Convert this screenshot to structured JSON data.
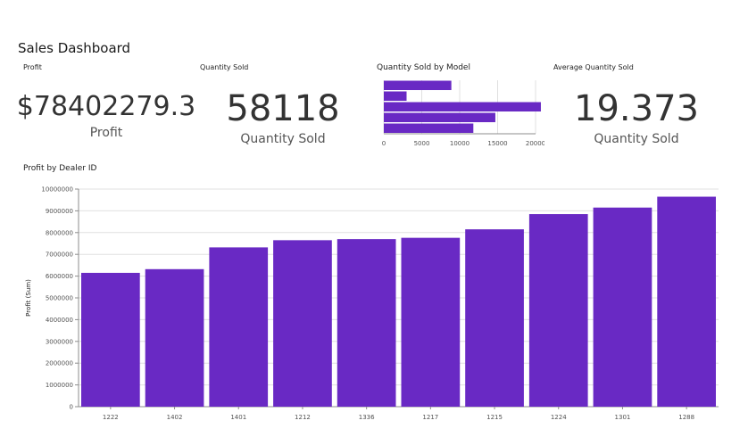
{
  "dashboard": {
    "title": "Sales Dashboard"
  },
  "tiles": {
    "profit": {
      "title": "Profit",
      "value": "$78402279.3",
      "label": "Profit"
    },
    "quantity": {
      "title": "Quantity Sold",
      "value": "58118",
      "label": "Quantity Sold"
    },
    "model": {
      "title": "Quantity Sold by Model"
    },
    "average": {
      "title": "Average Quantity Sold",
      "value": "19.373",
      "label": "Quantity Sold"
    },
    "dealer": {
      "title": "Profit by Dealer ID"
    }
  },
  "colors": {
    "bar": "#6929c4",
    "grid": "#e0e0e0",
    "axis": "#8d8d8d"
  },
  "chart_data": [
    {
      "type": "bar",
      "orientation": "horizontal",
      "title": "Quantity Sold by Model",
      "values": [
        8900,
        3000,
        20700,
        14700,
        11800
      ],
      "xlim": [
        0,
        20000
      ],
      "xticks": [
        "0",
        "5000",
        "10000",
        "15000",
        "20000"
      ],
      "grid": true
    },
    {
      "type": "bar",
      "title": "Profit by Dealer ID",
      "ylabel": "Profit (Sum)",
      "categories": [
        "1222",
        "1402",
        "1401",
        "1212",
        "1336",
        "1217",
        "1215",
        "1224",
        "1301",
        "1288"
      ],
      "values": [
        6150000,
        6320000,
        7320000,
        7650000,
        7700000,
        7760000,
        8150000,
        8850000,
        9150000,
        9650000
      ],
      "ylim": [
        0,
        10000000
      ],
      "yticks": [
        "0",
        "1000000",
        "2000000",
        "3000000",
        "4000000",
        "5000000",
        "6000000",
        "7000000",
        "8000000",
        "9000000",
        "10000000"
      ],
      "grid": true
    }
  ]
}
